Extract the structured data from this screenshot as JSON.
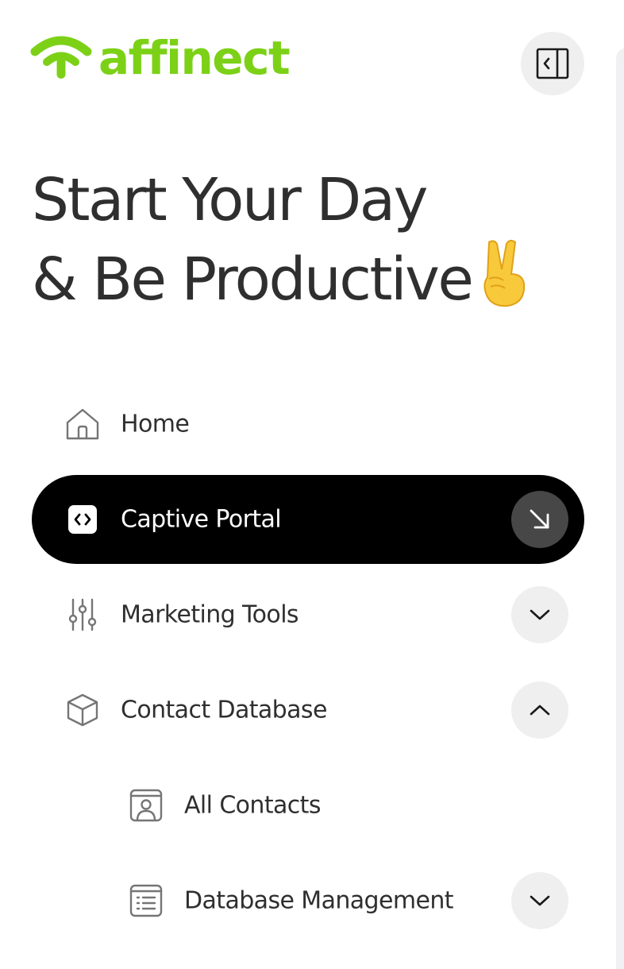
{
  "brand": {
    "name": "affinect",
    "color": "#7cd117"
  },
  "header": {
    "greeting_line1": "Start Your Day",
    "greeting_line2": "& Be Productive",
    "greeting_emoji": "victory-hand-emoji"
  },
  "nav": {
    "items": [
      {
        "label": "Home",
        "icon": "home-icon",
        "active": false,
        "chevron": "none"
      },
      {
        "label": "Captive Portal",
        "icon": "code-icon",
        "active": true,
        "chevron": "arrow-down-right"
      },
      {
        "label": "Marketing Tools",
        "icon": "sliders-icon",
        "active": false,
        "chevron": "down"
      },
      {
        "label": "Contact Database",
        "icon": "cube-icon",
        "active": false,
        "chevron": "up",
        "expanded": true
      },
      {
        "label": "All Contacts",
        "icon": "contact-card-icon",
        "active": false,
        "chevron": "none",
        "sub": true
      },
      {
        "label": "Database Management",
        "icon": "list-icon",
        "active": false,
        "chevron": "down",
        "sub": true
      }
    ]
  },
  "colors": {
    "active_bg": "#000000",
    "text": "#2f2f2f",
    "button_bg": "#efefef"
  }
}
